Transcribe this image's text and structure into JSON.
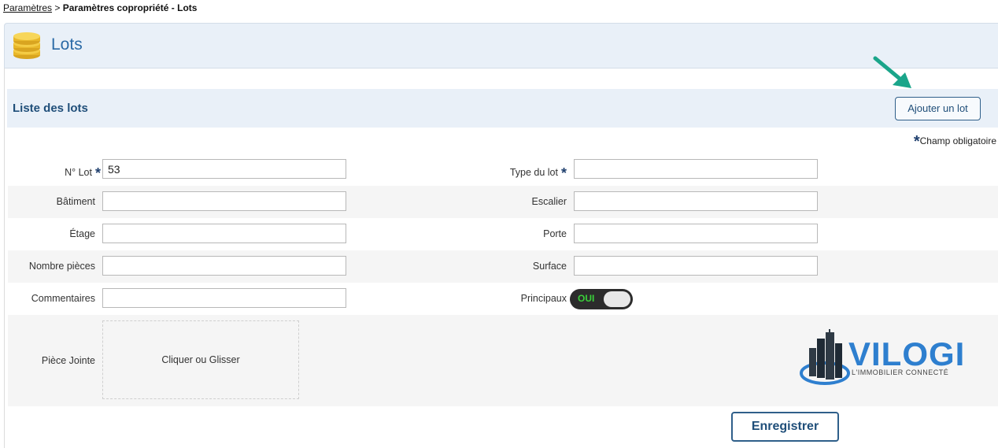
{
  "breadcrumb": {
    "parent": "Paramètres",
    "separator": ">",
    "current": "Paramètres copropriété - Lots"
  },
  "header": {
    "title": "Lots",
    "icon": "coins-icon"
  },
  "section": {
    "title": "Liste des lots",
    "add_button": "Ajouter un lot"
  },
  "required_note": {
    "star": "*",
    "text": "Champ obligatoire"
  },
  "form": {
    "lot_number": {
      "label": "N° Lot",
      "value": "53",
      "required_mark": "*"
    },
    "lot_type": {
      "label": "Type du lot",
      "value": "",
      "required_mark": "*"
    },
    "building": {
      "label": "Bâtiment",
      "value": ""
    },
    "staircase": {
      "label": "Escalier",
      "value": ""
    },
    "floor": {
      "label": "Étage",
      "value": ""
    },
    "door": {
      "label": "Porte",
      "value": ""
    },
    "rooms": {
      "label": "Nombre pièces",
      "value": ""
    },
    "surface": {
      "label": "Surface",
      "value": ""
    },
    "comments": {
      "label": "Commentaires",
      "value": ""
    },
    "main": {
      "label": "Principaux",
      "toggle_text": "OUI",
      "toggle_on": true
    },
    "attachment": {
      "label": "Pièce Jointe",
      "dropzone_text": "Cliquer ou Glisser"
    }
  },
  "logo": {
    "brand": "VILOGI",
    "tagline": "L'IMMOBILIER CONNECTÉ"
  },
  "save_button": "Enregistrer",
  "colors": {
    "accent": "#2b6aa6",
    "header_bg": "#e9f0f8",
    "arrow": "#1aa58a",
    "toggle_on_text": "#3ad13a"
  }
}
